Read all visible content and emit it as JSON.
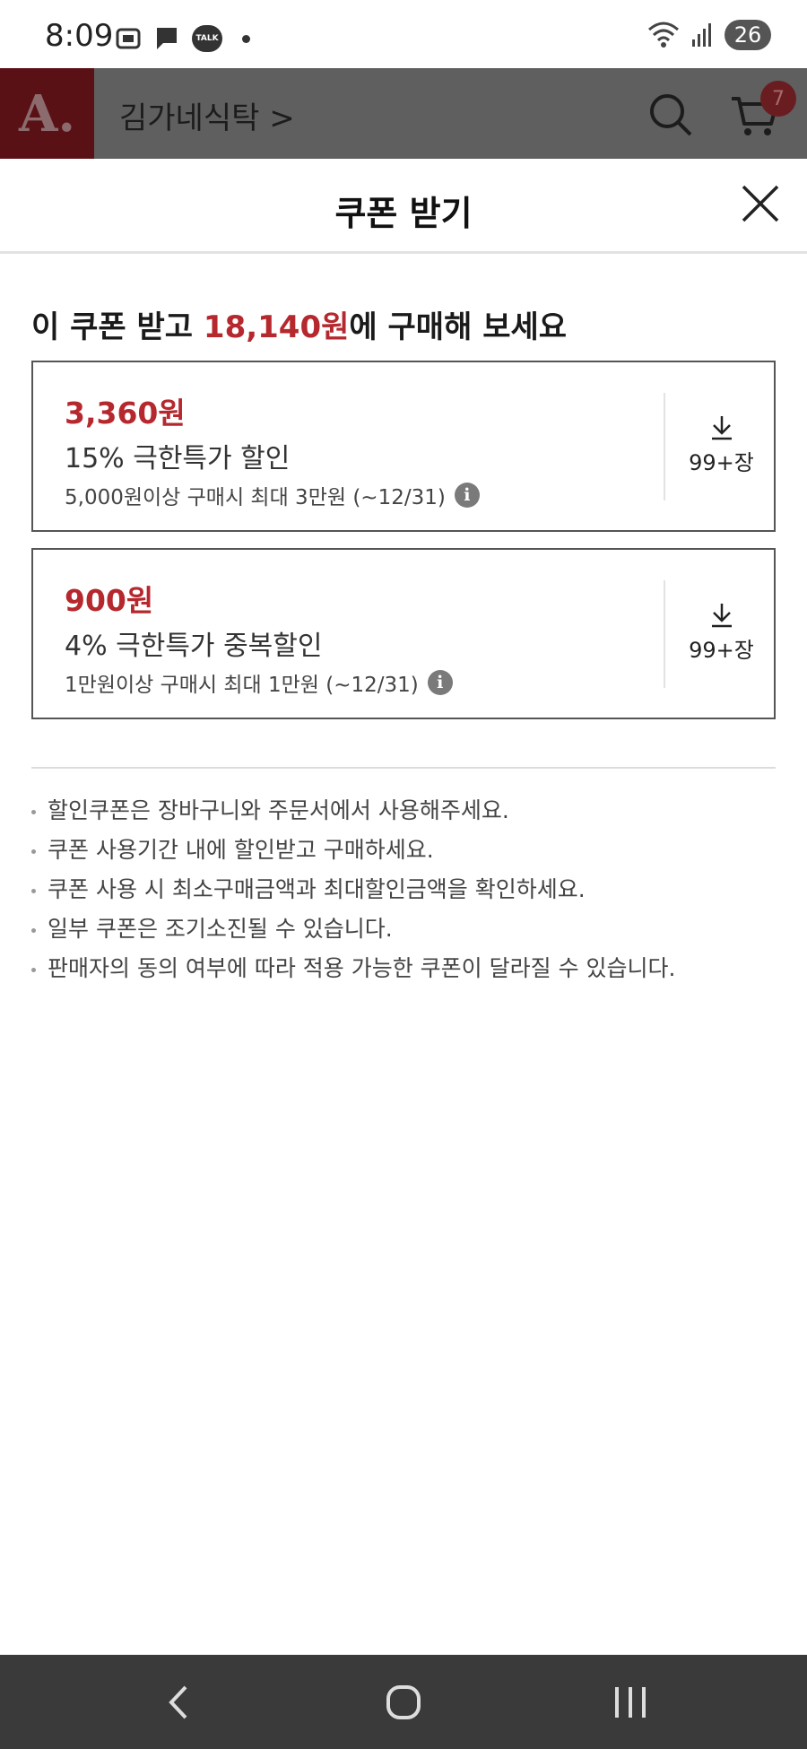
{
  "status_bar": {
    "time": "8:09",
    "left_icons": [
      "screenshot-icon",
      "message-icon",
      "kakaotalk-icon",
      "dot-icon"
    ],
    "kakaotalk_label": "TALK",
    "battery": "26"
  },
  "header": {
    "logo": "A.",
    "store_name": "김가네식탁 >",
    "cart_count": "7"
  },
  "sheet": {
    "title": "쿠폰 받기",
    "headline_pre": "이 쿠폰 받고 ",
    "headline_price": "18,140원",
    "headline_post": "에 구매해 보세요",
    "coupons": [
      {
        "amount": "3,360원",
        "name": "15% 극한특가 할인",
        "condition": "5,000원이상 구매시 최대 3만원 (~12/31)",
        "count": "99+장"
      },
      {
        "amount": "900원",
        "name": "4% 극한특가 중복할인",
        "condition": "1만원이상 구매시 최대 1만원 (~12/31)",
        "count": "99+장"
      }
    ],
    "notices": [
      "할인쿠폰은 장바구니와 주문서에서 사용해주세요.",
      "쿠폰 사용기간 내에 할인받고 구매하세요.",
      "쿠폰 사용 시 최소구매금액과 최대할인금액을 확인하세요.",
      "일부 쿠폰은 조기소진될 수 있습니다.",
      "판매자의 동의 여부에 따라 적용 가능한 쿠폰이 달라질 수 있습니다."
    ]
  },
  "colors": {
    "accent": "#b5282e",
    "nav_bar": "#3a3a3a",
    "header_dim": "#5f5f5f"
  }
}
